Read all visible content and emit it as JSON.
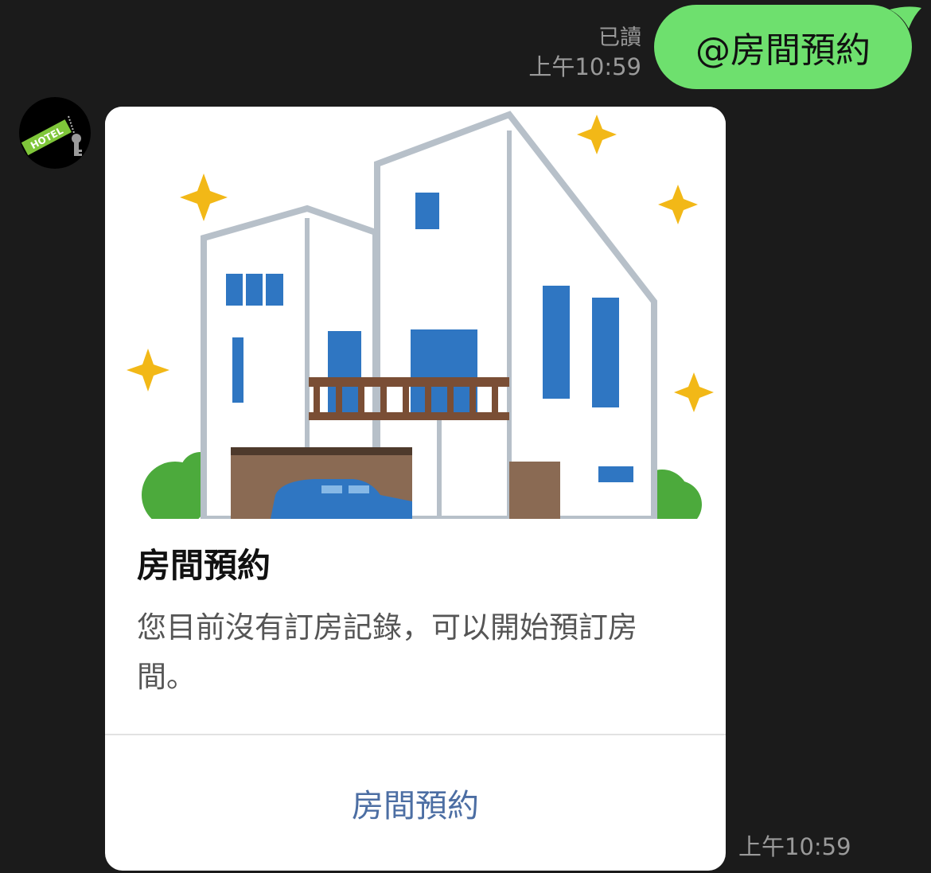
{
  "chat": {
    "sent_message": {
      "text": "@房間預約",
      "read_status": "已讀",
      "time": "上午10:59",
      "bubble_color": "#6ee06e"
    },
    "bot": {
      "avatar_icon": "hotel-key-tag-icon",
      "avatar_label": "HOTEL"
    },
    "card": {
      "hero_image": "hotel-building-illustration",
      "title": "房間預約",
      "description": "您目前沒有訂房記錄，可以開始預訂房間。",
      "button_label": "房間預約",
      "button_color": "#4c6ea3"
    },
    "received_time": "上午10:59"
  }
}
